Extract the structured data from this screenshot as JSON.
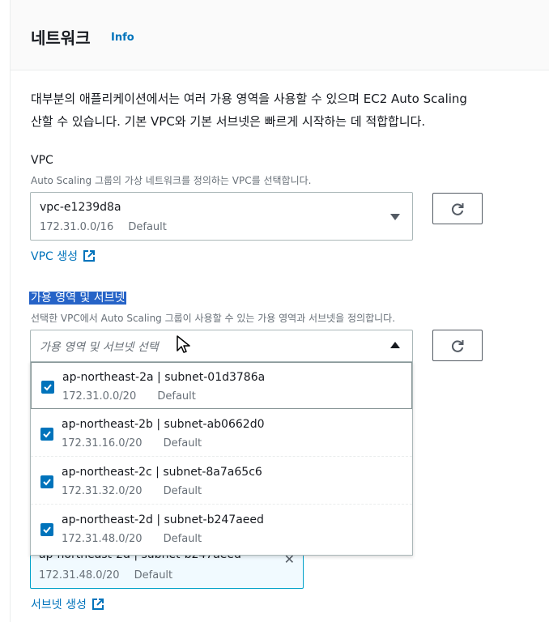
{
  "section": {
    "title": "네트워크",
    "info_link": "Info",
    "description_line1": "대부분의 애플리케이션에서는 여러 가용 영역을 사용할 수 있으며 EC2 Auto Scaling",
    "description_line2": "산할 수 있습니다. 기본 VPC와 기본 서브넷은 빠르게 시작하는 데 적합합니다."
  },
  "vpc": {
    "label": "VPC",
    "sublabel": "Auto Scaling 그룹의 가상 네트워크를 정의하는 VPC를 선택합니다.",
    "selected_id": "vpc-e1239d8a",
    "selected_cidr": "172.31.0.0/16",
    "selected_default": "Default",
    "create_link": "VPC 생성"
  },
  "az": {
    "label": "가용 영역 및 서브넷",
    "sublabel": "선택한 VPC에서 Auto Scaling 그룹이 사용할 수 있는 가용 영역과 서브넷을 정의합니다.",
    "placeholder": "가용 영역 및 서브넷 선택",
    "options": [
      {
        "label": "ap-northeast-2a | subnet-01d3786a",
        "cidr": "172.31.0.0/20",
        "tag": "Default",
        "checked": true
      },
      {
        "label": "ap-northeast-2b | subnet-ab0662d0",
        "cidr": "172.31.16.0/20",
        "tag": "Default",
        "checked": true
      },
      {
        "label": "ap-northeast-2c | subnet-8a7a65c6",
        "cidr": "172.31.32.0/20",
        "tag": "Default",
        "checked": true
      },
      {
        "label": "ap-northeast-2d | subnet-b247aeed",
        "cidr": "172.31.48.0/20",
        "tag": "Default",
        "checked": true
      }
    ],
    "token": {
      "label": "ap-northeast-2d | subnet-b247aeed",
      "cidr": "172.31.48.0/20",
      "tag": "Default"
    },
    "create_subnet_link": "서브넷 생성"
  },
  "colors": {
    "link": "#0073bb",
    "checkbox": "#0073bb",
    "highlight": "#2663c7"
  },
  "icons": [
    "refresh-icon",
    "external-link-icon",
    "caret-down-icon",
    "caret-up-icon",
    "check-icon",
    "close-icon",
    "mouse-cursor-icon"
  ]
}
